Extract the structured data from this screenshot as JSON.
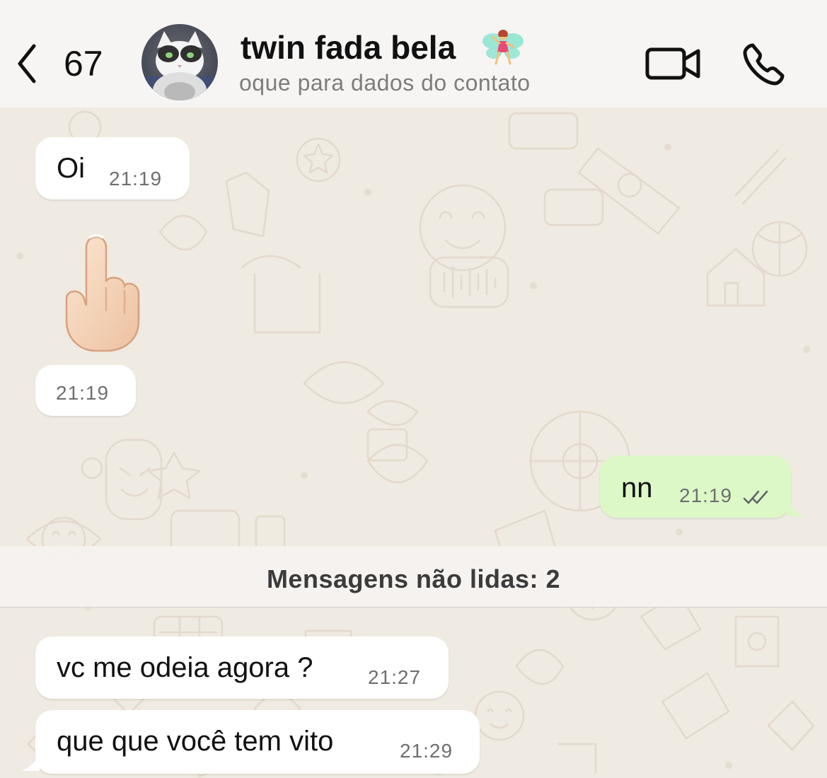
{
  "header": {
    "back_count": "67",
    "contact_name": "twin fada  bela",
    "subtitle": "oque para dados do contato"
  },
  "messages": [
    {
      "direction": "incoming",
      "text": "Oi",
      "time": "21:19"
    },
    {
      "direction": "incoming",
      "text": "",
      "time": "21:19",
      "content": "middle-finger-emoji"
    },
    {
      "direction": "outgoing",
      "text": "nn",
      "time": "21:19",
      "status": "read"
    },
    {
      "direction": "incoming",
      "text": "vc me odeia agora ?",
      "time": "21:27"
    },
    {
      "direction": "incoming",
      "text": "que que você tem vito",
      "time": "21:29"
    }
  ],
  "unread_banner": "Mensagens não lidas: 2",
  "colors": {
    "header_bg": "#f6f5f3",
    "chat_bg": "#efeae2",
    "incoming_bubble": "#ffffff",
    "outgoing_bubble": "#dcf8c6",
    "read_tick": "#5f6368"
  },
  "icons": [
    "back-chevron-icon",
    "fairy-icon",
    "video-call-icon",
    "phone-call-icon",
    "double-check-icon"
  ]
}
